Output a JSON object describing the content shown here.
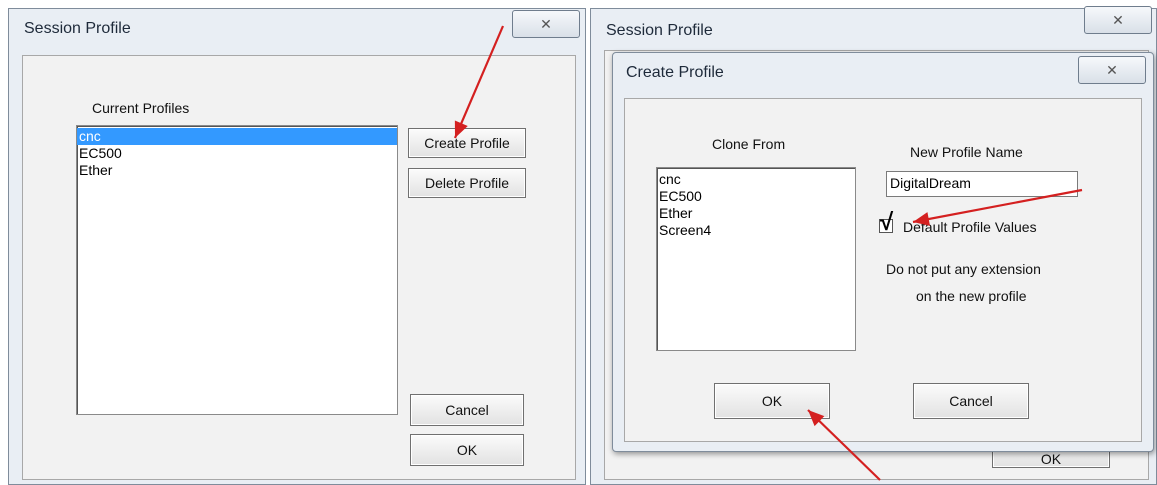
{
  "left_window": {
    "title": "Session Profile",
    "close_glyph": "✕",
    "profiles_label": "Current Profiles",
    "profiles": [
      "cnc",
      "EC500",
      "Ether"
    ],
    "selected_profile": "cnc",
    "buttons": {
      "create": "Create Profile",
      "delete": "Delete Profile",
      "cancel": "Cancel",
      "ok": "OK"
    }
  },
  "right_window": {
    "title": "Session Profile",
    "close_glyph": "✕",
    "hidden_ok": "OK"
  },
  "create_dialog": {
    "title": "Create Profile",
    "close_glyph": "✕",
    "clone_from_label": "Clone From",
    "clone_items": [
      "cnc",
      "EC500",
      "Ether",
      "Screen4"
    ],
    "new_name_label": "New Profile Name",
    "new_name_value": "DigitalDream",
    "default_values_label": "Default Profile Values",
    "default_values_checked": true,
    "checkmark_glyph": "√",
    "note_line1": "Do not put any extension",
    "note_line2": "on the new profile",
    "ok": "OK",
    "cancel": "Cancel"
  },
  "annotation_color": "#d42020"
}
